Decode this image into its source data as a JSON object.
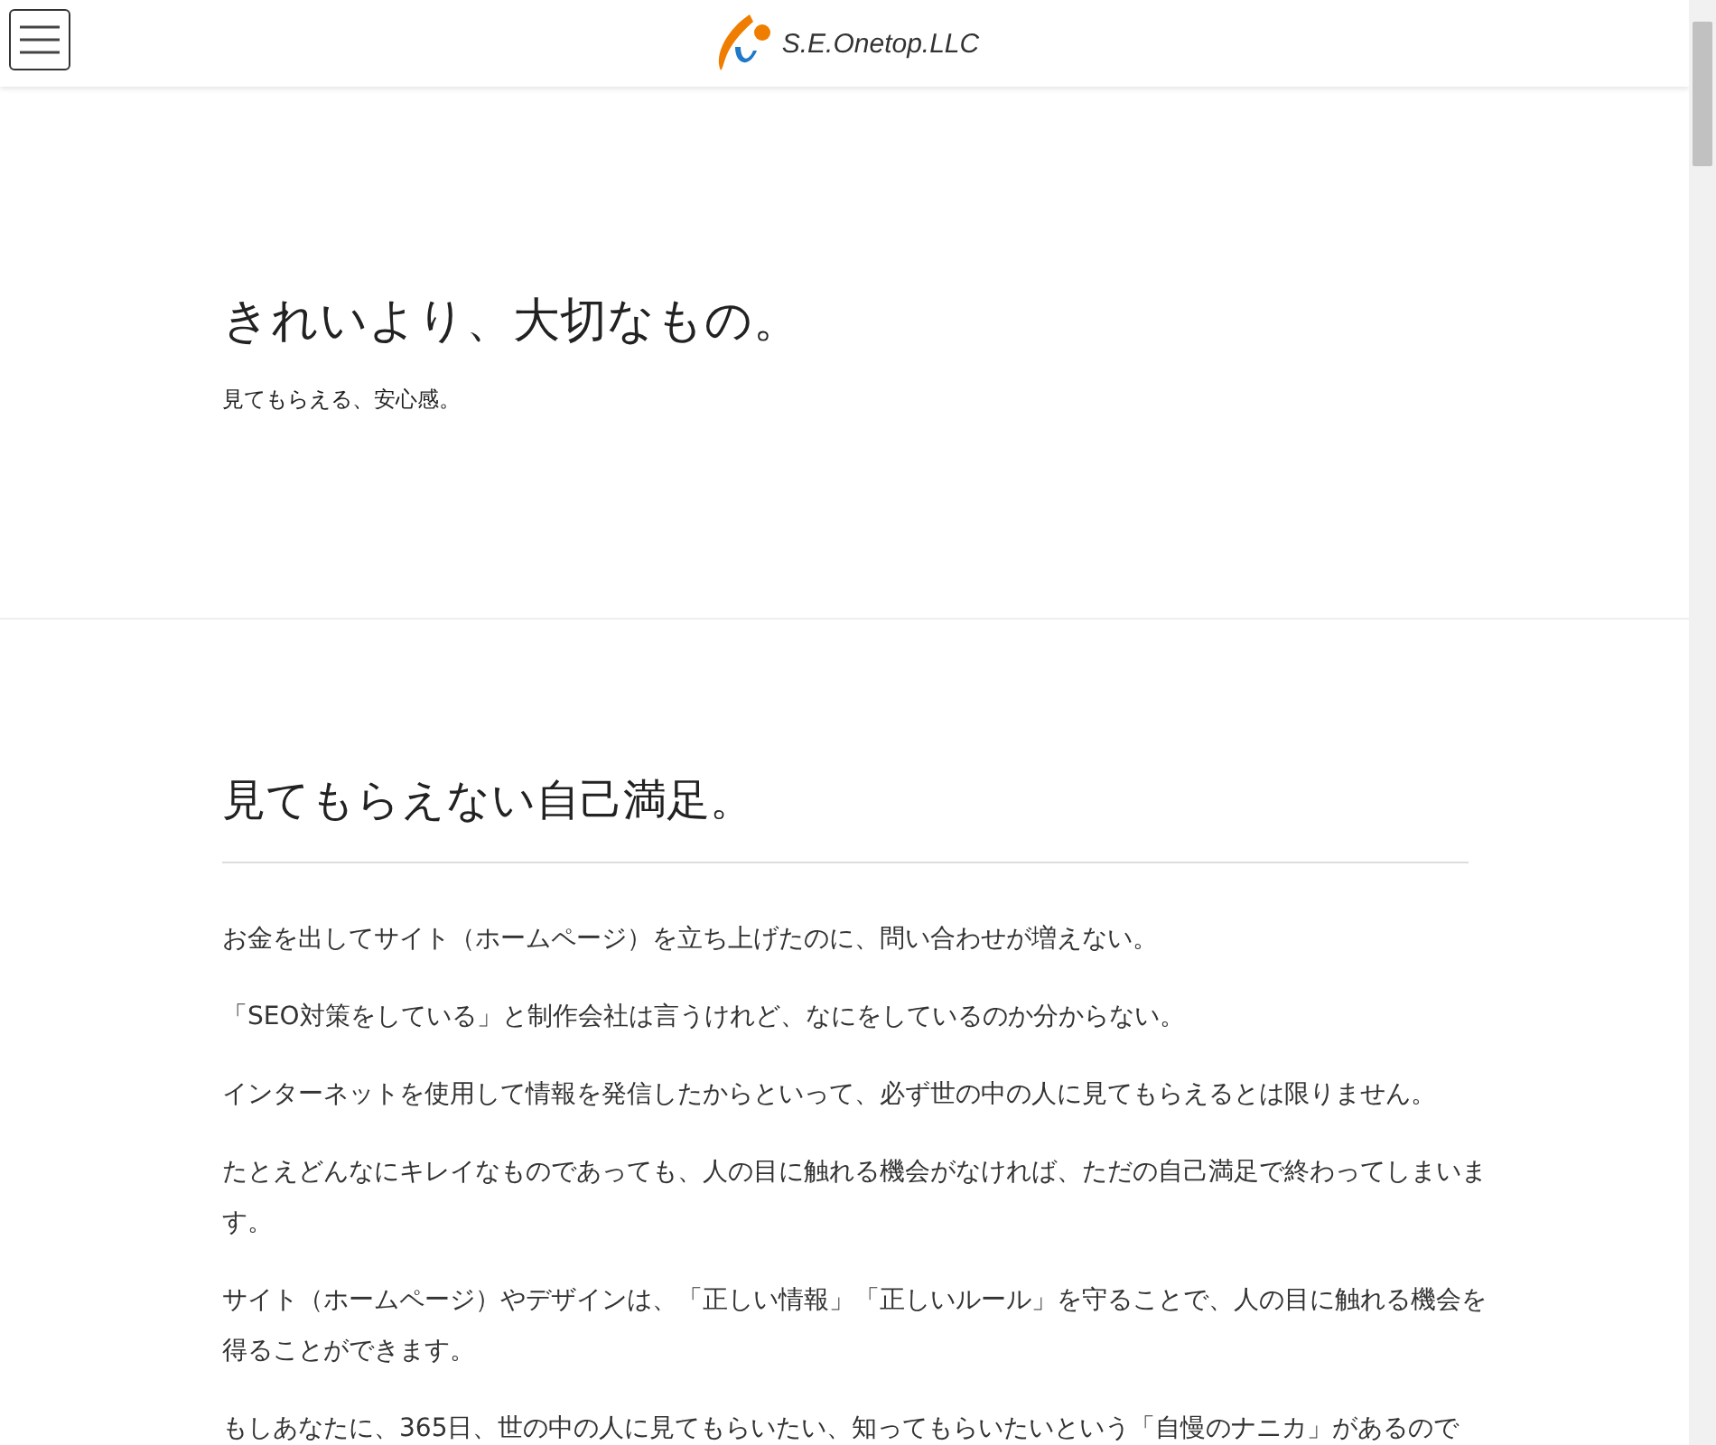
{
  "header": {
    "logo_text": "S.E.Onetop.LLC"
  },
  "hero": {
    "title": "きれいより、大切なもの。",
    "subtitle": "見てもらえる、安心感。"
  },
  "section": {
    "title": "見てもらえない自己満足。",
    "paragraphs": [
      "お金を出してサイト（ホームページ）を立ち上げたのに、問い合わせが増えない。",
      "「SEO対策をしている」と制作会社は言うけれど、なにをしているのか分からない。",
      "インターネットを使用して情報を発信したからといって、必ず世の中の人に見てもらえるとは限りません。",
      "たとえどんなにキレイなものであっても、人の目に触れる機会がなければ、ただの自己満足で終わってしまいます。",
      "サイト（ホームページ）やデザインは、「正しい情報」「正しいルール」を守ることで、人の目に触れる機会を得ることができます。",
      "もしあなたに、365日、世の中の人に見てもらいたい、知ってもらいたいという「自慢のナニカ」があるので"
    ]
  }
}
